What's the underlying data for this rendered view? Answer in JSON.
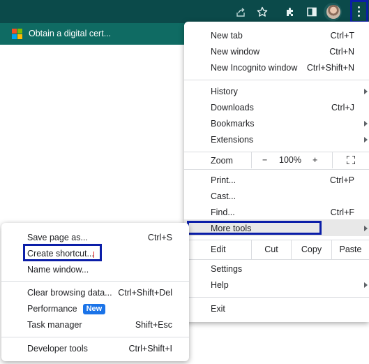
{
  "toolbar": {
    "icons": [
      "share-icon",
      "star-icon",
      "extensions-icon",
      "side-panel-icon",
      "profile-avatar",
      "chrome-menu-icon"
    ],
    "colors": {
      "toolbar_bg": "#0b4a4a",
      "bookmarks_bg": "#0f6b63",
      "highlight_outline": "#0b1ea8"
    }
  },
  "bookmarks": {
    "item_label": "Obtain a digital cert..."
  },
  "main_menu": {
    "new_tab": {
      "label": "New tab",
      "shortcut": "Ctrl+T"
    },
    "new_window": {
      "label": "New window",
      "shortcut": "Ctrl+N"
    },
    "new_incognito": {
      "label": "New Incognito window",
      "shortcut": "Ctrl+Shift+N"
    },
    "history": {
      "label": "History"
    },
    "downloads": {
      "label": "Downloads",
      "shortcut": "Ctrl+J"
    },
    "bookmarks": {
      "label": "Bookmarks"
    },
    "extensions": {
      "label": "Extensions"
    },
    "zoom": {
      "label": "Zoom",
      "minus": "−",
      "value": "100%",
      "plus": "+"
    },
    "print": {
      "label": "Print...",
      "shortcut": "Ctrl+P"
    },
    "cast": {
      "label": "Cast..."
    },
    "find": {
      "label": "Find...",
      "shortcut": "Ctrl+F"
    },
    "more_tools": {
      "label": "More tools"
    },
    "edit": {
      "label": "Edit",
      "cut": "Cut",
      "copy": "Copy",
      "paste": "Paste"
    },
    "settings": {
      "label": "Settings"
    },
    "help": {
      "label": "Help"
    },
    "exit": {
      "label": "Exit"
    }
  },
  "sub_menu": {
    "save_page": {
      "label": "Save page as...",
      "shortcut": "Ctrl+S"
    },
    "create_shortcut": {
      "label": "Create shortcut..."
    },
    "name_window": {
      "label": "Name window..."
    },
    "clear_browsing": {
      "label": "Clear browsing data...",
      "shortcut": "Ctrl+Shift+Del"
    },
    "performance": {
      "label": "Performance",
      "badge": "New"
    },
    "task_manager": {
      "label": "Task manager",
      "shortcut": "Shift+Esc"
    },
    "developer_tools": {
      "label": "Developer tools",
      "shortcut": "Ctrl+Shift+I"
    }
  }
}
